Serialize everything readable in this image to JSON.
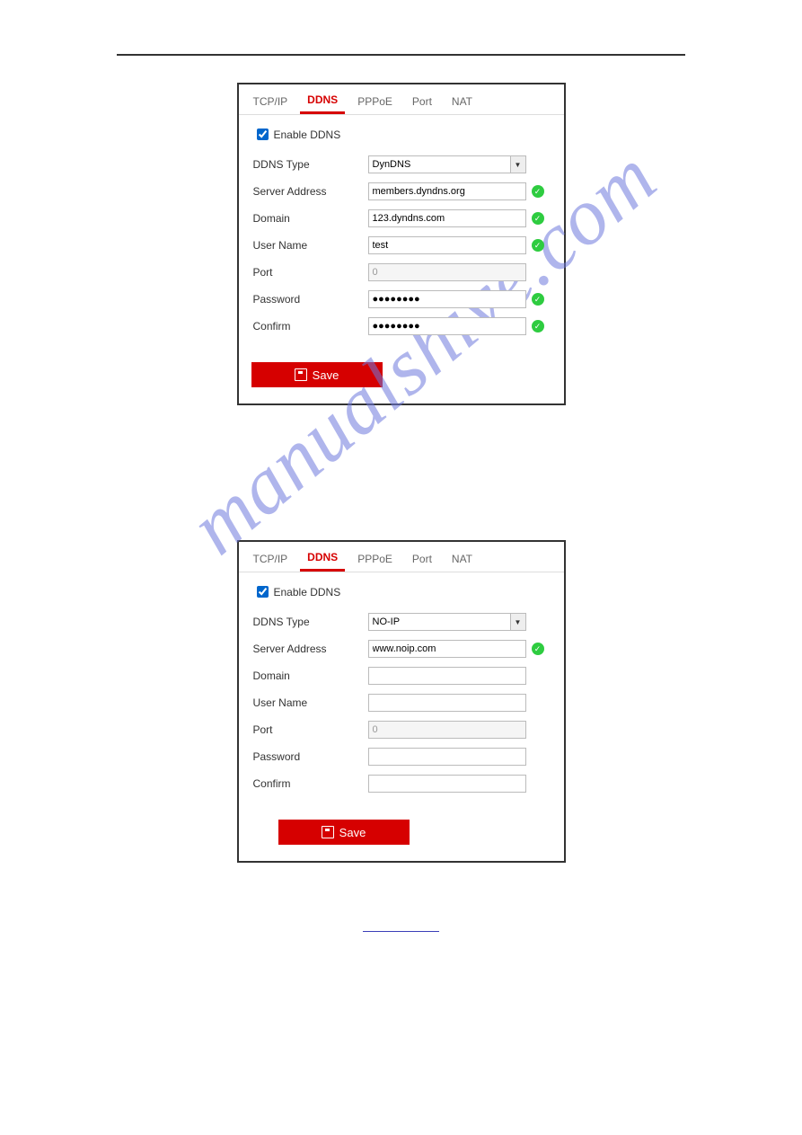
{
  "tabs": {
    "tcpip": "TCP/IP",
    "ddns": "DDNS",
    "pppoe": "PPPoE",
    "port": "Port",
    "nat": "NAT"
  },
  "labels": {
    "enable_ddns": "Enable DDNS",
    "ddns_type": "DDNS Type",
    "server_address": "Server Address",
    "domain": "Domain",
    "user_name": "User Name",
    "port": "Port",
    "password": "Password",
    "confirm": "Confirm",
    "save": "Save"
  },
  "panel1": {
    "ddns_type": "DynDNS",
    "server_address": "members.dyndns.org",
    "domain": "123.dyndns.com",
    "user_name": "test",
    "port": "0",
    "password": "●●●●●●●●",
    "confirm": "●●●●●●●●"
  },
  "panel2": {
    "ddns_type": "NO-IP",
    "server_address": "www.noip.com",
    "domain": "",
    "user_name": "",
    "port": "0",
    "password": "",
    "confirm": ""
  },
  "link_text": "",
  "watermark": "manualshive.com"
}
